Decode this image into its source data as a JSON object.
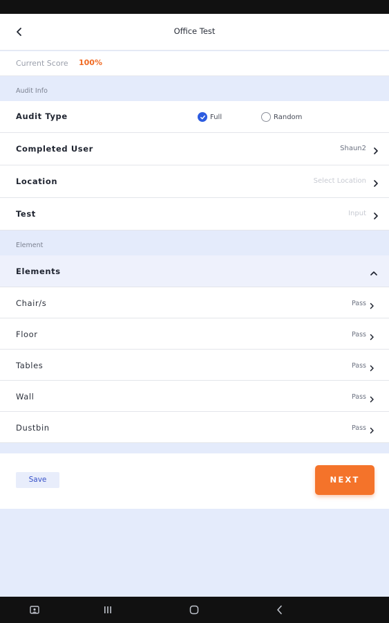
{
  "header": {
    "title": "Office Test"
  },
  "score": {
    "label": "Current Score",
    "value": "100%"
  },
  "sections": {
    "audit_info": "Audit Info",
    "element": "Element"
  },
  "audit_type": {
    "label": "Audit Type",
    "options": [
      {
        "label": "Full",
        "selected": true
      },
      {
        "label": "Random",
        "selected": false
      }
    ]
  },
  "completed_user": {
    "label": "Completed User",
    "value": "Shaun2"
  },
  "location": {
    "label": "Location",
    "placeholder": "Select Location"
  },
  "test": {
    "label": "Test",
    "placeholder": "Input"
  },
  "elements": {
    "header": "Elements",
    "items": [
      {
        "label": "Chair/s",
        "status": "Pass"
      },
      {
        "label": "Floor",
        "status": "Pass"
      },
      {
        "label": "Tables",
        "status": "Pass"
      },
      {
        "label": "Wall",
        "status": "Pass"
      },
      {
        "label": "Dustbin",
        "status": "Pass"
      }
    ]
  },
  "footer": {
    "save_label": "Save",
    "next_label": "NEXT"
  },
  "colors": {
    "accent": "#f4732a",
    "score": "#f06a23",
    "primary": "#2d5ce0",
    "section_bg": "#e4ebfb"
  },
  "icons": {
    "back": "chevron-left-icon",
    "row_chevron": "chevron-right-icon",
    "collapse": "chevron-up-icon",
    "nav": [
      "screenshot-icon",
      "recent-apps-icon",
      "home-icon",
      "back-nav-icon"
    ]
  }
}
